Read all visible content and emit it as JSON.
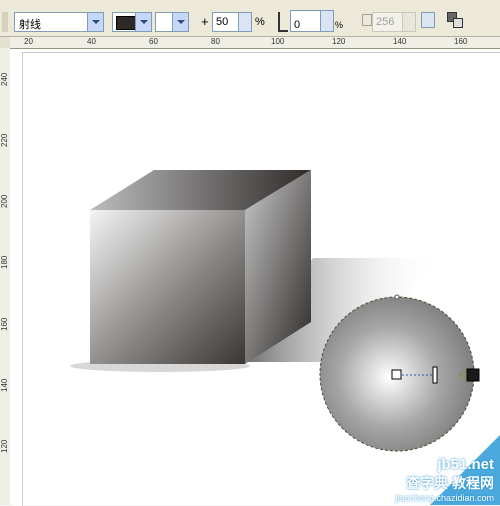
{
  "toolbar": {
    "fill_type": "射线",
    "color_value": "",
    "midpoint_label": "+",
    "midpoint_value": "50",
    "percent_symbol": "%",
    "angle_value": "0",
    "angle_unit": "%",
    "steps_value": "256"
  },
  "ruler": {
    "top_ticks": [
      "20",
      "40",
      "60",
      "80",
      "100",
      "120",
      "140",
      "160"
    ],
    "left_ticks": [
      "240",
      "220",
      "200",
      "180",
      "160",
      "140",
      "120"
    ]
  },
  "watermark": {
    "line1": "jb51.net",
    "line2": "查字典 教程网",
    "line3": "jiaocheng.chazidian.com"
  },
  "colors": {
    "shape_dark": "#2d2a27",
    "shape_light": "#ffffff",
    "selection_outline": "#4d4d30"
  }
}
